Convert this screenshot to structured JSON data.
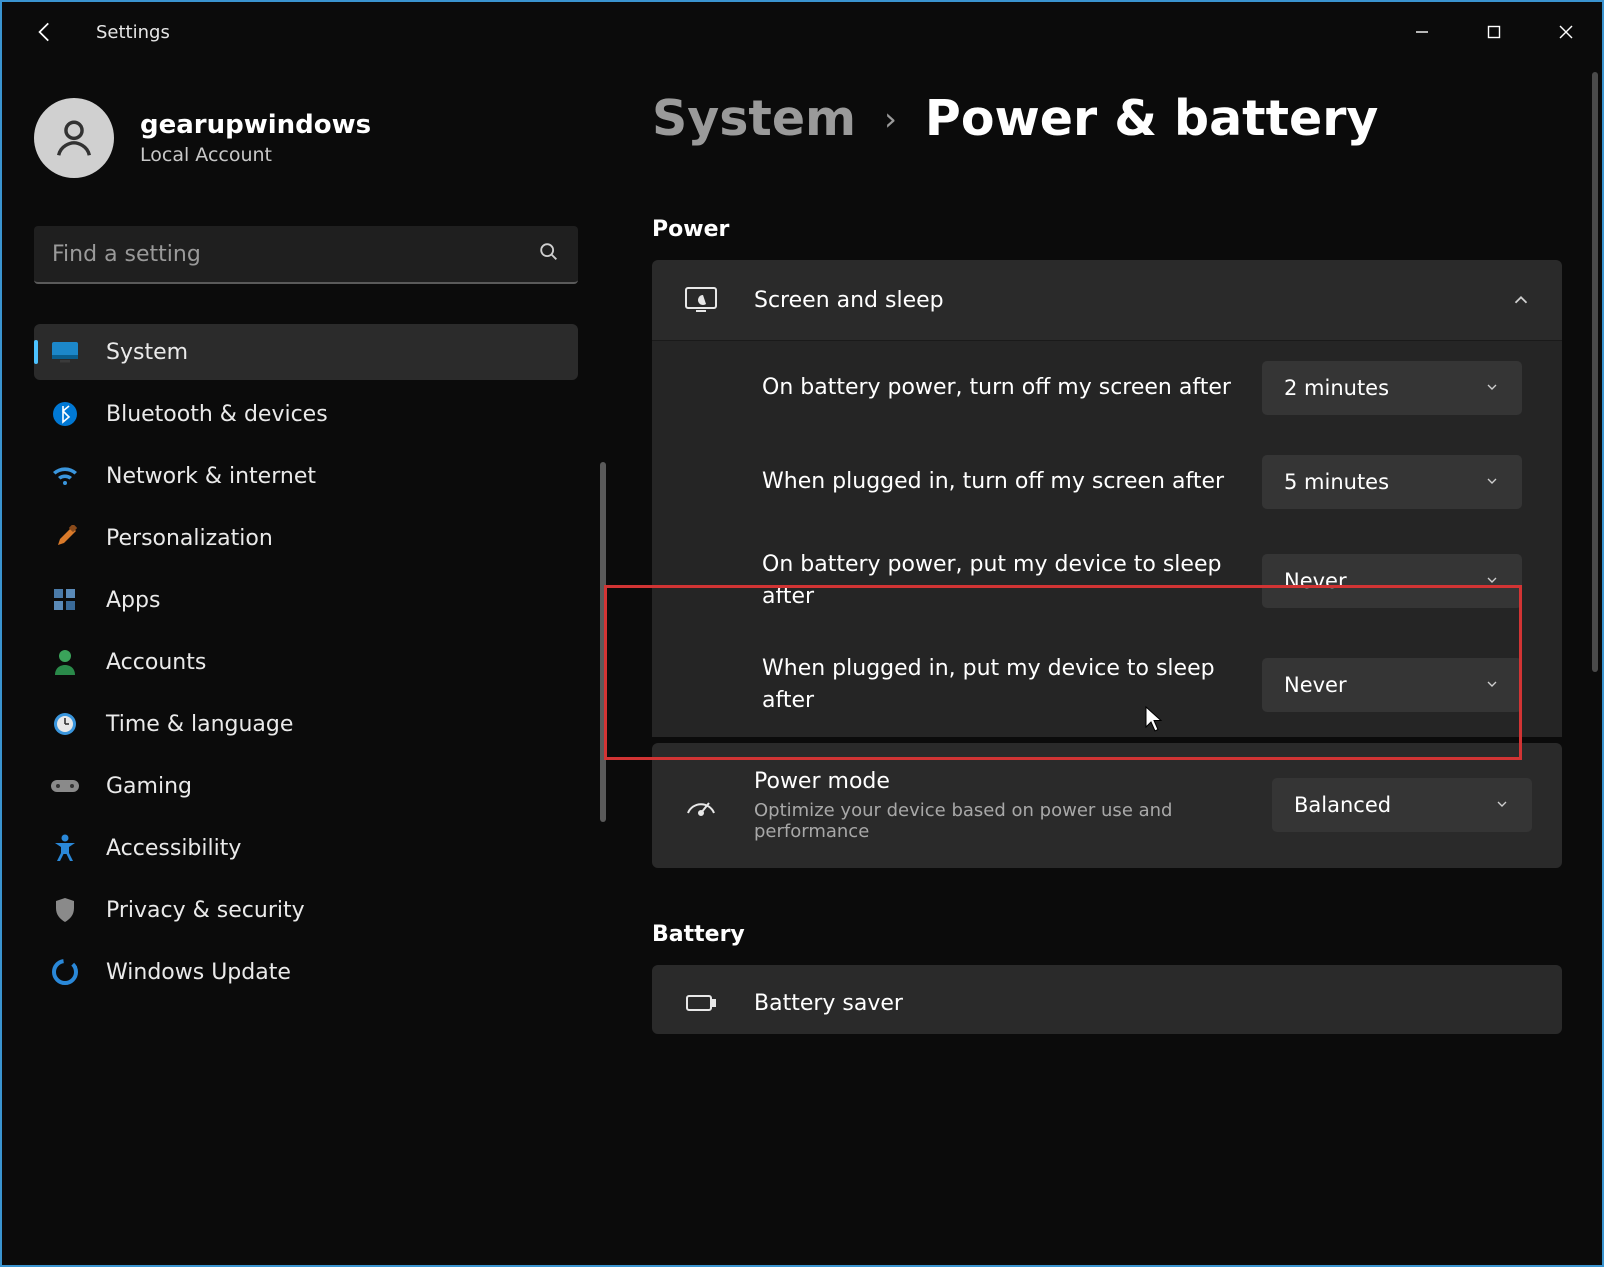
{
  "titlebar": {
    "app_title": "Settings"
  },
  "user": {
    "name": "gearupwindows",
    "account_type": "Local Account"
  },
  "search": {
    "placeholder": "Find a setting"
  },
  "nav": {
    "items": [
      {
        "label": "System",
        "icon": "monitor-icon",
        "active": true
      },
      {
        "label": "Bluetooth & devices",
        "icon": "bluetooth-icon"
      },
      {
        "label": "Network & internet",
        "icon": "wifi-icon"
      },
      {
        "label": "Personalization",
        "icon": "paintbrush-icon"
      },
      {
        "label": "Apps",
        "icon": "apps-icon"
      },
      {
        "label": "Accounts",
        "icon": "person-icon"
      },
      {
        "label": "Time & language",
        "icon": "clock-icon"
      },
      {
        "label": "Gaming",
        "icon": "gamepad-icon"
      },
      {
        "label": "Accessibility",
        "icon": "accessibility-icon"
      },
      {
        "label": "Privacy & security",
        "icon": "shield-icon"
      },
      {
        "label": "Windows Update",
        "icon": "update-icon"
      }
    ]
  },
  "breadcrumb": {
    "parent": "System",
    "current": "Power & battery"
  },
  "sections": {
    "power_title": "Power",
    "battery_title": "Battery"
  },
  "screen_sleep": {
    "title": "Screen and sleep",
    "rows": [
      {
        "label": "On battery power, turn off my screen after",
        "value": "2 minutes"
      },
      {
        "label": "When plugged in, turn off my screen after",
        "value": "5 minutes"
      },
      {
        "label": "On battery power, put my device to sleep after",
        "value": "Never"
      },
      {
        "label": "When plugged in, put my device to sleep after",
        "value": "Never"
      }
    ]
  },
  "power_mode": {
    "title": "Power mode",
    "subtitle": "Optimize your device based on power use and performance",
    "value": "Balanced"
  },
  "battery_saver": {
    "title": "Battery saver"
  }
}
